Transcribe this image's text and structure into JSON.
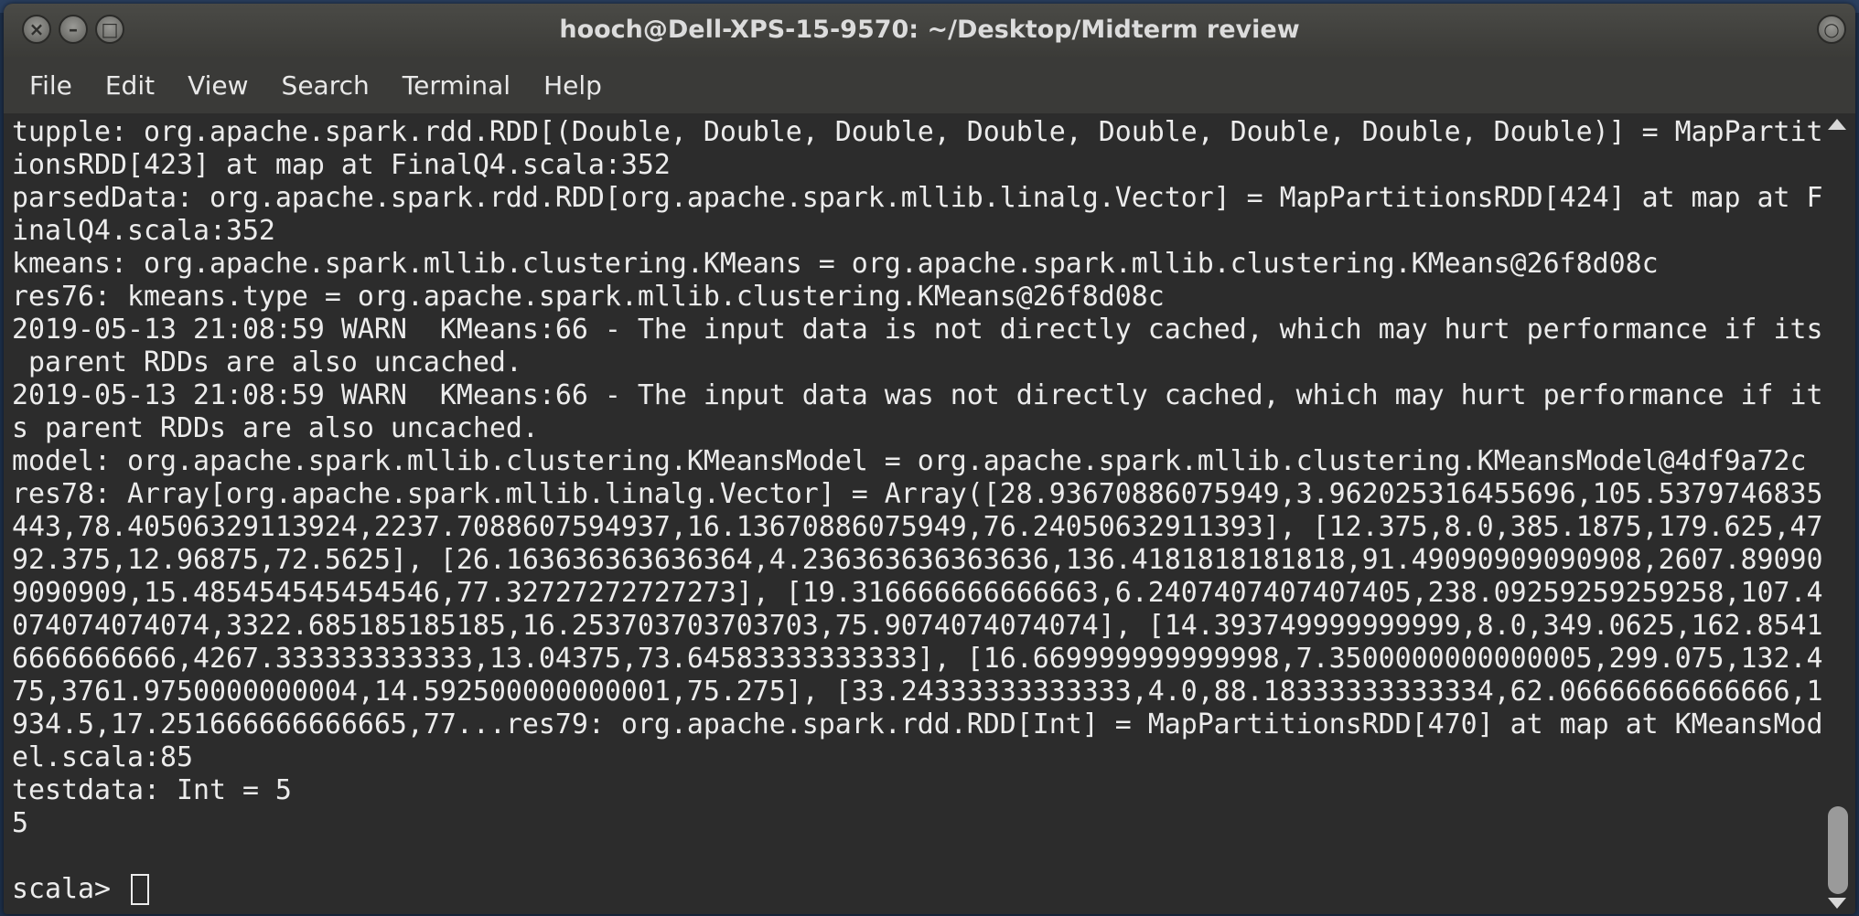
{
  "window": {
    "title": "hooch@Dell-XPS-15-9570: ~/Desktop/Midterm review"
  },
  "menu": {
    "items": [
      "File",
      "Edit",
      "View",
      "Search",
      "Terminal",
      "Help"
    ]
  },
  "terminal": {
    "lines": [
      "tupple: org.apache.spark.rdd.RDD[(Double, Double, Double, Double, Double, Double, Double, Double)] = MapPartit",
      "ionsRDD[423] at map at FinalQ4.scala:352",
      "parsedData: org.apache.spark.rdd.RDD[org.apache.spark.mllib.linalg.Vector] = MapPartitionsRDD[424] at map at F",
      "inalQ4.scala:352",
      "kmeans: org.apache.spark.mllib.clustering.KMeans = org.apache.spark.mllib.clustering.KMeans@26f8d08c",
      "res76: kmeans.type = org.apache.spark.mllib.clustering.KMeans@26f8d08c",
      "2019-05-13 21:08:59 WARN  KMeans:66 - The input data is not directly cached, which may hurt performance if its",
      " parent RDDs are also uncached.",
      "2019-05-13 21:08:59 WARN  KMeans:66 - The input data was not directly cached, which may hurt performance if it",
      "s parent RDDs are also uncached.",
      "model: org.apache.spark.mllib.clustering.KMeansModel = org.apache.spark.mllib.clustering.KMeansModel@4df9a72c",
      "res78: Array[org.apache.spark.mllib.linalg.Vector] = Array([28.93670886075949,3.962025316455696,105.5379746835",
      "443,78.40506329113924,2237.7088607594937,16.13670886075949,76.24050632911393], [12.375,8.0,385.1875,179.625,47",
      "92.375,12.96875,72.5625], [26.163636363636364,4.236363636363636,136.4181818181818,91.49090909090908,2607.89090",
      "9090909,15.485454545454546,77.32727272727273], [19.316666666666663,6.2407407407407405,238.09259259259258,107.4",
      "074074074074,3322.685185185185,16.253703703703703,75.9074074074074], [14.393749999999999,8.0,349.0625,162.8541",
      "6666666666,4267.333333333333,13.04375,73.64583333333333], [16.669999999999998,7.3500000000000005,299.075,132.4",
      "75,3761.9750000000004,14.592500000000001,75.275], [33.24333333333333,4.0,88.18333333333334,62.06666666666666,1",
      "934.5,17.251666666666665,77...res79: org.apache.spark.rdd.RDD[Int] = MapPartitionsRDD[470] at map at KMeansMod",
      "el.scala:85",
      "testdata: Int = 5",
      "5",
      ""
    ],
    "prompt": "scala> "
  }
}
